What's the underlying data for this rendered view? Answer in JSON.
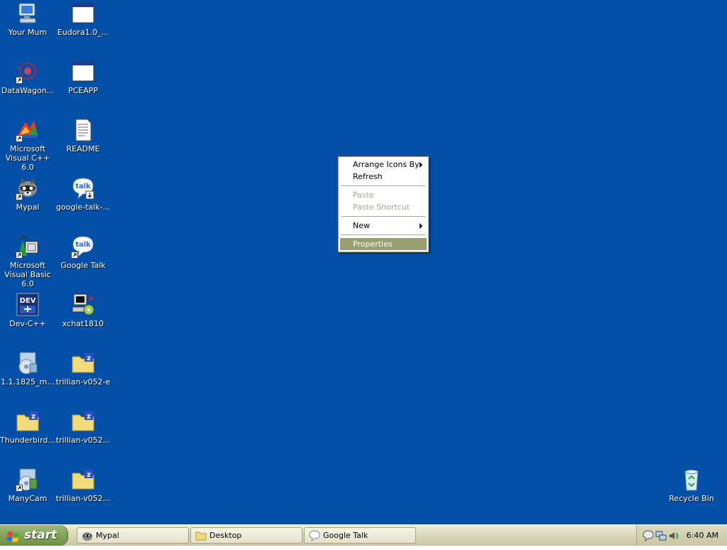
{
  "desktop": {
    "background": "#0450a8",
    "icons": [
      {
        "label": "Your Mum",
        "icon": "my-computer-icon"
      },
      {
        "label": "Eudora1.0_...",
        "icon": "program-window-icon"
      },
      {
        "label": "DataWagon...",
        "icon": "datawagon-icon"
      },
      {
        "label": "PCEAPP",
        "icon": "program-window-icon"
      },
      {
        "label": "Microsoft Visual C++ 6.0",
        "icon": "visual-cpp-icon"
      },
      {
        "label": "README",
        "icon": "text-document-icon"
      },
      {
        "label": "Mypal",
        "icon": "mypal-raccoon-icon"
      },
      {
        "label": "google-talk-...",
        "icon": "google-talk-installer-icon"
      },
      {
        "label": "Microsoft Visual Basic 6.0",
        "icon": "visual-basic-icon"
      },
      {
        "label": "Google Talk",
        "icon": "google-talk-icon"
      },
      {
        "label": "Dev-C++",
        "icon": "dev-cpp-icon"
      },
      {
        "label": "xchat1810",
        "icon": "xchat-installer-icon"
      },
      {
        "label": "1.1.1825_m...",
        "icon": "installer-cd-icon"
      },
      {
        "label": "trillian-v052-e",
        "icon": "zip-folder-icon"
      },
      {
        "label": "Thunderbird...",
        "icon": "zip-folder-icon"
      },
      {
        "label": "trillian-v052...",
        "icon": "zip-folder-icon"
      },
      {
        "label": "ManyCam",
        "icon": "manycam-icon"
      },
      {
        "label": "trillian-v052...",
        "icon": "zip-folder-icon"
      },
      {
        "label": "Recycle Bin",
        "icon": "recycle-bin-icon"
      }
    ]
  },
  "context_menu": {
    "highlight_color": "#9a9f71",
    "items": [
      {
        "label": "Arrange Icons By",
        "submenu": true,
        "disabled": false
      },
      {
        "label": "Refresh",
        "submenu": false,
        "disabled": false
      },
      {
        "label": "Paste",
        "submenu": false,
        "disabled": true
      },
      {
        "label": "Paste Shortcut",
        "submenu": false,
        "disabled": true
      },
      {
        "label": "New",
        "submenu": true,
        "disabled": false
      },
      {
        "label": "Properties",
        "submenu": false,
        "disabled": false,
        "highlighted": true
      }
    ]
  },
  "taskbar": {
    "start_label": "start",
    "buttons": [
      {
        "label": "Mypal",
        "icon": "mypal-raccoon-icon"
      },
      {
        "label": "Desktop",
        "icon": "folder-icon"
      },
      {
        "label": "Google Talk",
        "icon": "chat-bubble-icon"
      }
    ],
    "tray": {
      "icons": [
        "chat-bubble-icon",
        "network-icon",
        "volume-icon"
      ],
      "clock": "6:40 AM"
    }
  }
}
